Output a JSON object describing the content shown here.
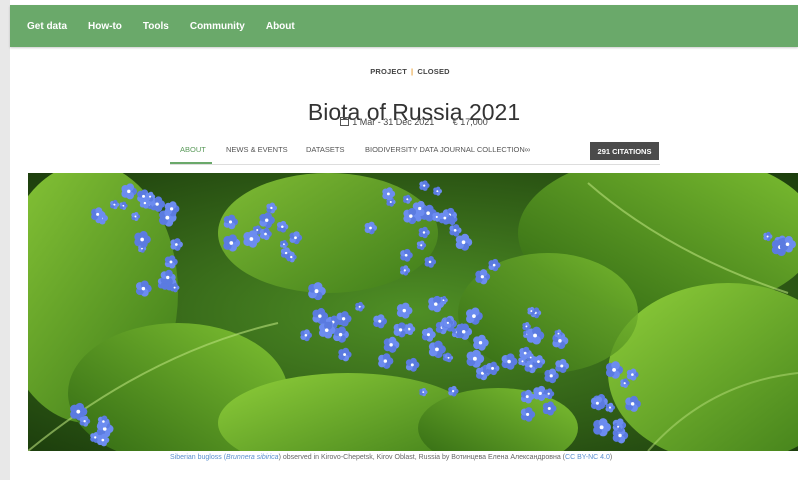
{
  "nav": {
    "items": [
      "Get data",
      "How-to",
      "Tools",
      "Community",
      "About"
    ]
  },
  "header": {
    "project_label": "PROJECT",
    "status_label": "CLOSED",
    "title": "Biota of Russia 2021",
    "dates": "1 Mar - 31 Dec 2021",
    "funding": "€ 17,000"
  },
  "tabs": [
    "ABOUT",
    "NEWS & EVENTS",
    "DATASETS",
    "BIODIVERSITY DATA JOURNAL COLLECTION∞"
  ],
  "citations_button": "291 CITATIONS",
  "caption": {
    "common_name": "Siberian bugloss (",
    "species": "Brunnera sibirica",
    "observed": ") observed in Kirovo-Chepetsk, Kirov Oblast, Russia by Вотинцева Елена Александровна (",
    "license": "CC BY-NC 4.0",
    "close": ")"
  },
  "colors": {
    "navbar": "#6aa96a",
    "status_separator": "#e8a13a",
    "citation_button": "#4b4b4b",
    "caption_link": "#5a8fcf"
  }
}
